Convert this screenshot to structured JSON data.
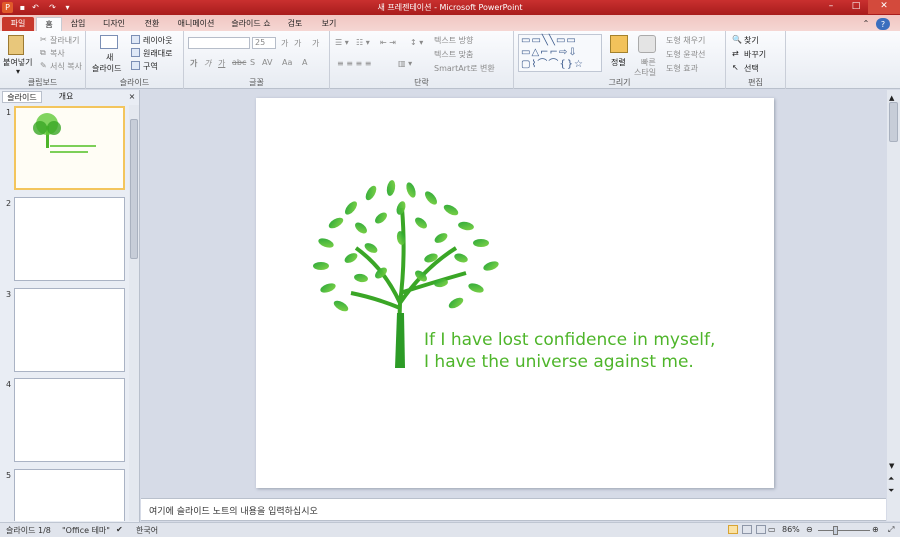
{
  "window": {
    "title": "새 프레젠테이션 - Microsoft PowerPoint",
    "min": "–",
    "max": "□",
    "close": "✕"
  },
  "tabs": {
    "file": "파일",
    "home": "홈",
    "insert": "삽입",
    "design": "디자인",
    "transitions": "전환",
    "animations": "애니메이션",
    "slideshow": "슬라이드 쇼",
    "review": "검토",
    "view": "보기"
  },
  "ribbon": {
    "clipboard": {
      "paste": "붙여넣기",
      "cut": "잘라내기",
      "copy": "복사",
      "format_painter": "서식 복사",
      "label": "클립보드"
    },
    "slides": {
      "new_line1": "새",
      "new_line2": "슬라이드",
      "layout": "레이아웃",
      "reset": "원래대로",
      "section": "구역",
      "label": "슬라이드"
    },
    "font": {
      "size": "25",
      "label": "글꼴",
      "bold": "가",
      "italic": "가",
      "underline": "가",
      "strike": "abc",
      "shadow": "S",
      "spacing": "AV",
      "case": "Aa",
      "grow": "가",
      "shrink": "가",
      "clear": "가"
    },
    "paragraph": {
      "text_direction": "텍스트 방향",
      "align_text": "텍스트 맞춤",
      "smartart": "SmartArt로 변환",
      "label": "단락"
    },
    "drawing": {
      "arrange": "정렬",
      "quick_styles_line1": "빠른",
      "quick_styles_line2": "스타일",
      "fill": "도형 채우기",
      "outline": "도형 윤곽선",
      "effects": "도형 효과",
      "label": "그리기"
    },
    "editing": {
      "find": "찾기",
      "replace": "바꾸기",
      "select": "선택",
      "label": "편집"
    }
  },
  "panel": {
    "tab_slides": "슬라이드",
    "tab_outline": "개요",
    "close": "×",
    "thumb_numbers": [
      "1",
      "2",
      "3",
      "4",
      "5"
    ]
  },
  "slide": {
    "quote_line1": "If I have lost confidence in myself,",
    "quote_line2": "I have the universe against me."
  },
  "notes": {
    "placeholder": "여기에 슬라이드 노트의 내용을 입력하십시오"
  },
  "status": {
    "slide_info": "슬라이드 1/8",
    "theme": "\"Office 테마\"",
    "language": "한국어",
    "zoom": "86%"
  },
  "colors": {
    "titlebar": "#b62423",
    "leaf": "#4eb52a",
    "thumb_selected": "#f3c55c"
  }
}
